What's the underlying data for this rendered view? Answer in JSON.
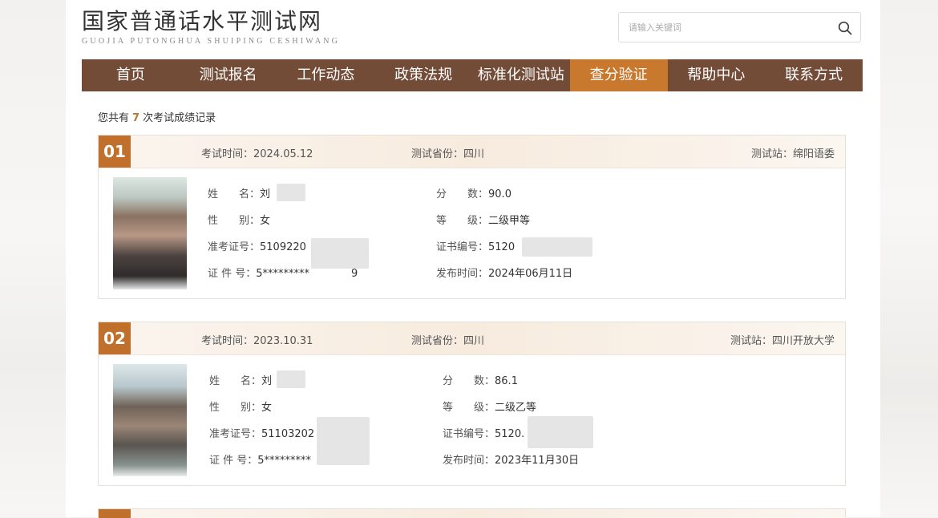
{
  "site": {
    "title_cn": "国家普通话水平测试网",
    "title_en": "GUOJIA PUTONGHUA SHUIPING CESHIWANG"
  },
  "search": {
    "placeholder": "请输入关键词",
    "icon": "search-icon"
  },
  "nav": {
    "items": [
      {
        "label": "首页"
      },
      {
        "label": "测试报名"
      },
      {
        "label": "工作动态"
      },
      {
        "label": "政策法规"
      },
      {
        "label": "标准化测试站"
      },
      {
        "label": "查分验证"
      },
      {
        "label": "帮助中心"
      },
      {
        "label": "联系方式"
      }
    ],
    "active_index": 5
  },
  "summary": {
    "prefix": "您共有",
    "count": "7",
    "suffix": "次考试成绩记录"
  },
  "records": [
    {
      "no": "01",
      "exam_time": "考试时间：2024.05.12",
      "province": "测试省份：四川",
      "station": "测试站：绵阳语委",
      "name_label": "姓　　名：",
      "name_value": "刘",
      "gender_label": "性　　别：",
      "gender_value": "女",
      "ticket_label": "准考证号：",
      "ticket_value": "5109220",
      "id_label": "证 件 号：",
      "id_value": "5*********　　　　9",
      "score_label": "分　　数：",
      "score_value": "90.0",
      "level_label": "等　　级：",
      "level_value": "二级甲等",
      "cert_label": "证书编号：",
      "cert_value": "5120",
      "publish_label": "发布时间：",
      "publish_value": "2024年06月11日"
    },
    {
      "no": "02",
      "exam_time": "考试时间：2023.10.31",
      "province": "测试省份：四川",
      "station": "测试站：四川开放大学",
      "name_label": "姓　　名：",
      "name_value": "刘",
      "gender_label": "性　　别：",
      "gender_value": "女",
      "ticket_label": "准考证号：",
      "ticket_value": "51103202",
      "id_label": "证 件 号：",
      "id_value": "5*********",
      "score_label": "分　　数：",
      "score_value": "86.1",
      "level_label": "等　　级：",
      "level_value": "二级乙等",
      "cert_label": "证书编号：",
      "cert_value": "5120.",
      "publish_label": "发布时间：",
      "publish_value": "2023年11月30日"
    }
  ],
  "colors": {
    "nav_bg": "#734c38",
    "nav_active": "#c8792d",
    "badge": "#c0702a"
  }
}
